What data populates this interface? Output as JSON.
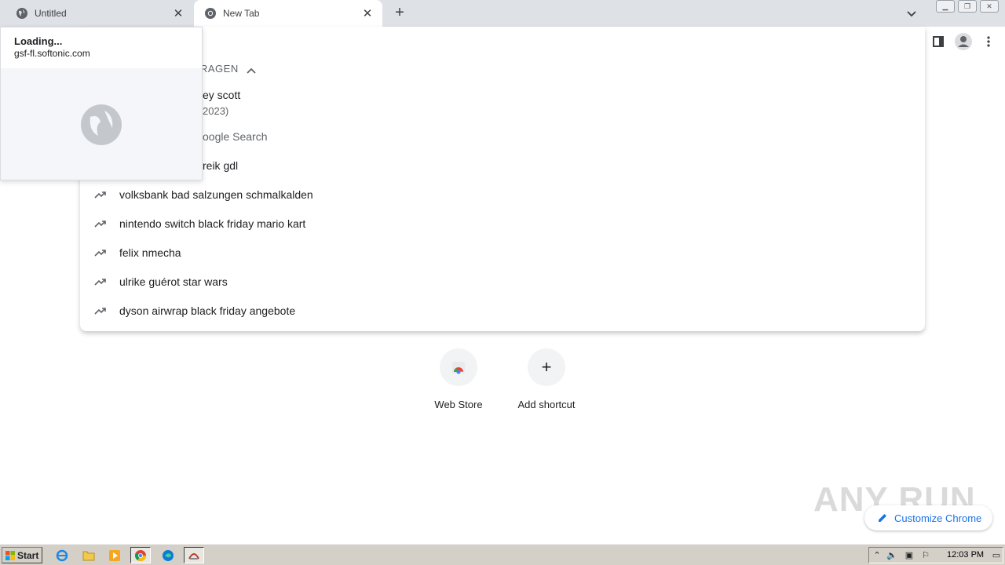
{
  "tabs": [
    {
      "title": "Untitled",
      "close": "✕"
    },
    {
      "title": "New Tab",
      "close": "✕"
    }
  ],
  "new_tab_glyph": "+",
  "hover_card": {
    "title": "Loading...",
    "url": "gsf-fl.softonic.com"
  },
  "dropdown": {
    "section_header_partial": "RAGEN",
    "partial_lines": [
      {
        "text": "ey scott"
      },
      {
        "text": "2023)"
      },
      {
        "text": "oogle Search"
      },
      {
        "text": "reik gdl"
      }
    ],
    "trending": [
      {
        "text": "volksbank bad salzungen schmalkalden",
        "icon": "trending-up-icon"
      },
      {
        "text": "nintendo switch black friday mario kart",
        "icon": "trending-up-icon"
      },
      {
        "text": "felix nmecha",
        "icon": "trending-up-icon"
      },
      {
        "text": "ulrike guérot star wars",
        "icon": "trending-up-icon"
      },
      {
        "text": "dyson airwrap black friday angebote",
        "icon": "trending-up-icon"
      }
    ]
  },
  "shortcuts": [
    {
      "label": "Web Store",
      "icon": "web-store-icon"
    },
    {
      "label": "Add shortcut",
      "icon": "plus-icon",
      "glyph": "+"
    }
  ],
  "customize": {
    "label": "Customize Chrome"
  },
  "watermark": "ANY RUN",
  "taskbar": {
    "start_label": "Start",
    "clock": "12:03 PM"
  },
  "colors": {
    "accent": "#1a73e8",
    "tabstrip": "#dee1e6",
    "taskbar": "#d4d0c8"
  }
}
